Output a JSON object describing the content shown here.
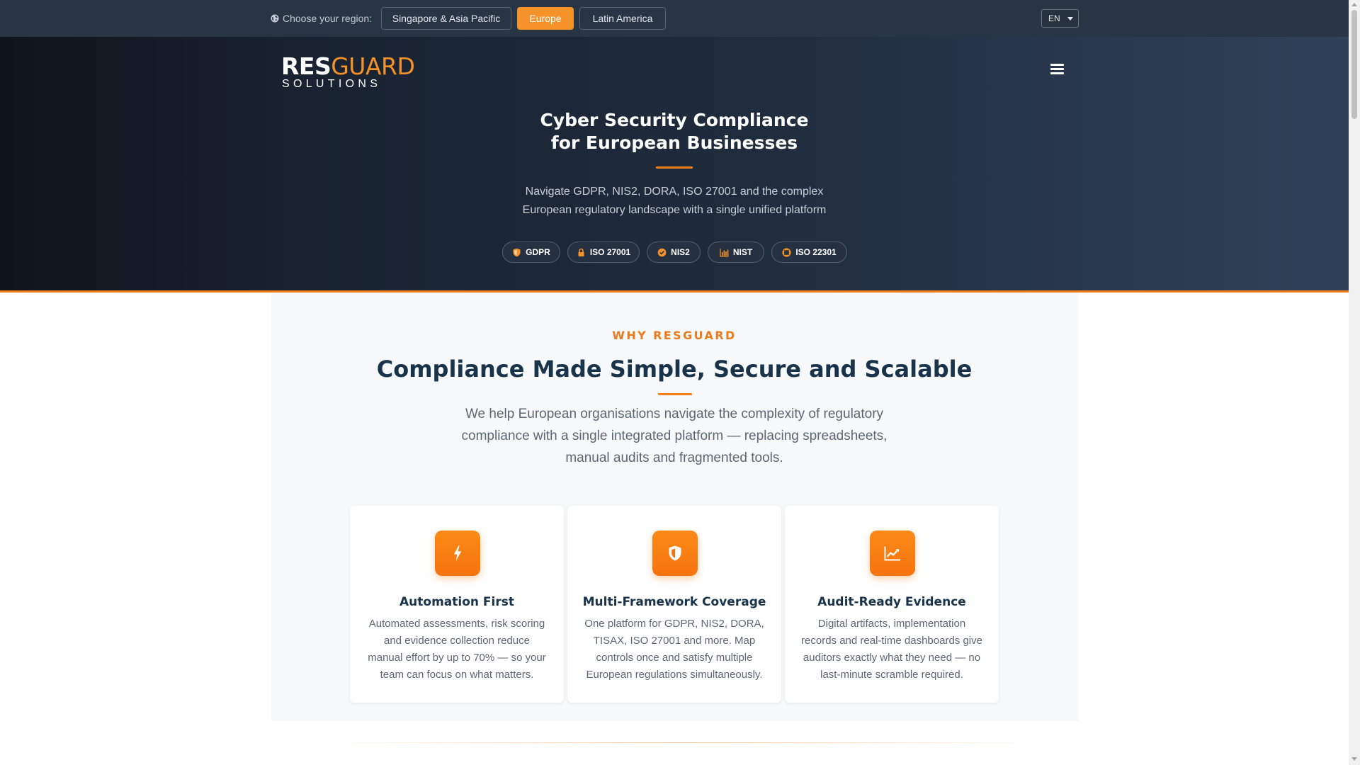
{
  "region_bar": {
    "label": "Choose your region:",
    "label_icon": "globe-icon",
    "regions": [
      {
        "label": "Singapore & Asia Pacific",
        "active": false
      },
      {
        "label": "Europe",
        "active": true
      },
      {
        "label": "Latin America",
        "active": false
      }
    ],
    "language": "EN"
  },
  "brand": {
    "logo_main_a": "RES",
    "logo_main_b": "GUARD",
    "logo_sub": "SOLUTIONS",
    "menu_icon": "hamburger-menu-icon"
  },
  "hero": {
    "title_line1": "Cyber Security Compliance",
    "title_line2": "for European Businesses",
    "subtitle_line1": "Navigate GDPR, NIS2, DORA, ISO 27001 and the complex",
    "subtitle_line2": "European regulatory landscape with a single unified platform",
    "badges": [
      {
        "label": "GDPR",
        "icon": "shield-icon"
      },
      {
        "label": "ISO 27001",
        "icon": "lock-icon"
      },
      {
        "label": "NIS2",
        "icon": "check-circle-icon"
      },
      {
        "label": "NIST",
        "icon": "bar-chart-icon"
      },
      {
        "label": "ISO 22301",
        "icon": "life-ring-icon"
      }
    ]
  },
  "why": {
    "eyebrow": "WHY RESGUARD",
    "title": "Compliance Made Simple, Secure and Scalable",
    "body_line1": "We help European organisations navigate the complexity of regulatory",
    "body_line2": "compliance with a single integrated platform — replacing spreadsheets,",
    "body_line3": "manual audits and fragmented tools.",
    "cards": [
      {
        "icon": "lightning-bolt-icon",
        "title": "Automation First",
        "lines": [
          "Automated assessments, risk scoring",
          "and evidence collection reduce",
          "manual effort by up to 70% — so your",
          "team can focus on what matters."
        ]
      },
      {
        "icon": "shield-icon",
        "title": "Multi-Framework Coverage",
        "lines": [
          "One platform for GDPR, NIS2, DORA,",
          "TISAX, ISO 27001 and more. Map",
          "controls once and satisfy multiple",
          "European regulations simultaneously."
        ]
      },
      {
        "icon": "line-chart-icon",
        "title": "Audit-Ready Evidence",
        "lines": [
          "Digital artifacts, implementation",
          "records and real-time dashboards give",
          "auditors exactly what they need — no",
          "last-minute scramble required."
        ]
      }
    ]
  },
  "colors": {
    "accent": "#f5922a",
    "navy_text": "#19334a",
    "topbar": "#283544"
  }
}
